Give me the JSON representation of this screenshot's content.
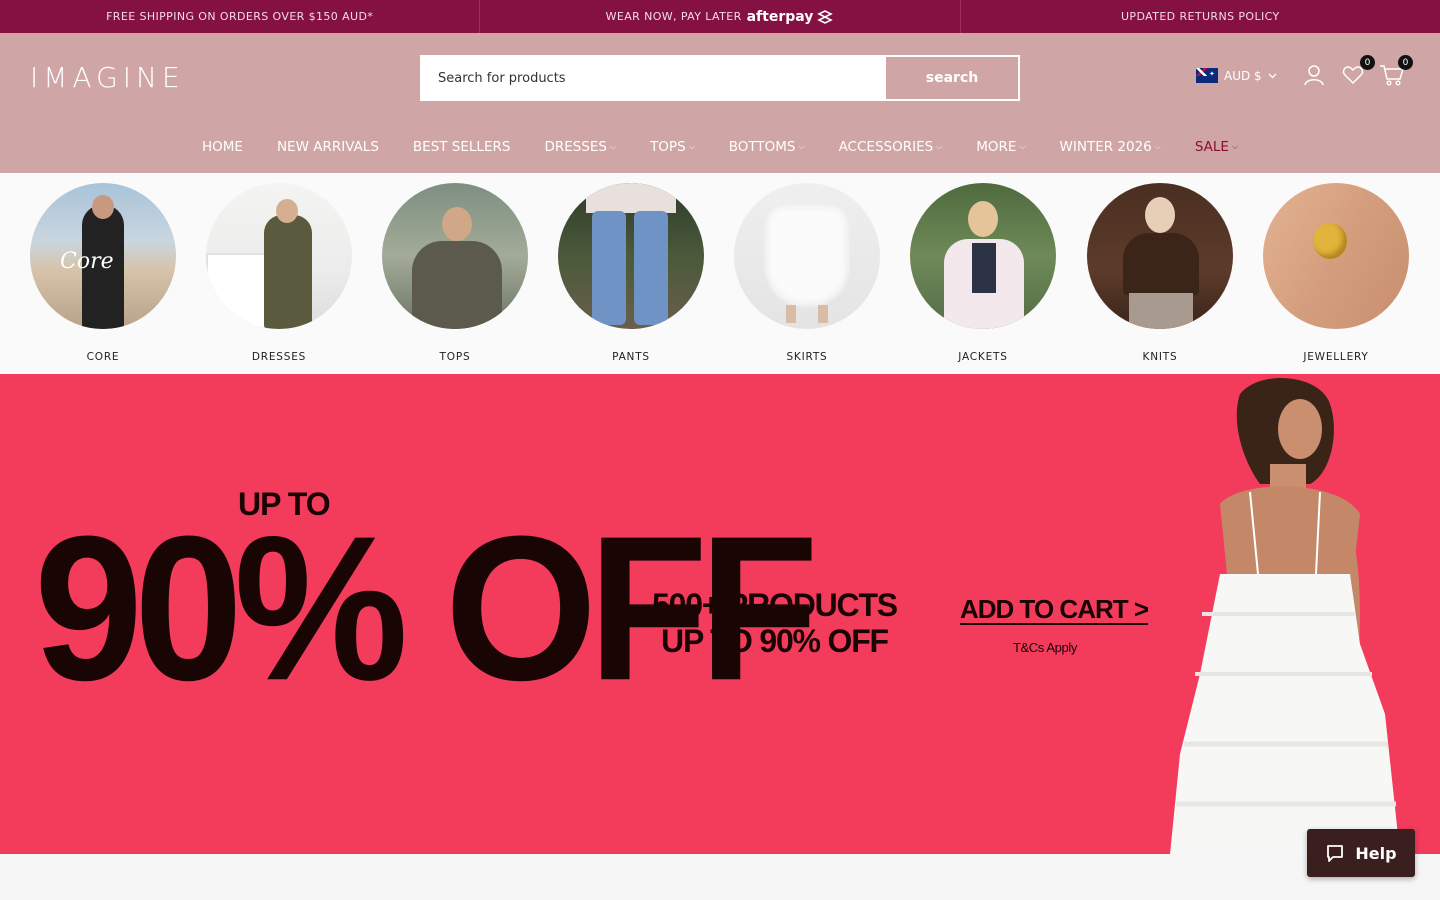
{
  "announcement": {
    "shipping": "FREE SHIPPING ON ORDERS OVER $150 AUD*",
    "wear_now": "WEAR NOW, PAY LATER",
    "afterpay": "afterpay",
    "returns": "UPDATED RETURNS POLICY"
  },
  "header": {
    "logo": "IMAGINE",
    "search_placeholder": "Search for products",
    "search_button": "search",
    "currency": "AUD $",
    "wishlist_count": "0",
    "cart_count": "0"
  },
  "nav": [
    {
      "label": "HOME",
      "dropdown": false
    },
    {
      "label": "NEW ARRIVALS",
      "dropdown": false
    },
    {
      "label": "BEST SELLERS",
      "dropdown": false
    },
    {
      "label": "DRESSES",
      "dropdown": true
    },
    {
      "label": "TOPS",
      "dropdown": true
    },
    {
      "label": "BOTTOMS",
      "dropdown": true
    },
    {
      "label": "ACCESSORIES",
      "dropdown": true
    },
    {
      "label": "MORE",
      "dropdown": true
    },
    {
      "label": "WINTER 2026",
      "dropdown": true
    },
    {
      "label": "SALE",
      "dropdown": true
    }
  ],
  "categories": [
    {
      "label": "CORE"
    },
    {
      "label": "DRESSES"
    },
    {
      "label": "TOPS"
    },
    {
      "label": "PANTS"
    },
    {
      "label": "SKIRTS"
    },
    {
      "label": "JACKETS"
    },
    {
      "label": "KNITS"
    },
    {
      "label": "JEWELLERY"
    }
  ],
  "hero": {
    "upto": "UP TO",
    "big": "90% OFF",
    "mid_line1": "500+ PRODUCTS",
    "mid_line2": "UP TO 90% OFF",
    "cta": "ADD TO CART >",
    "tcs": "T&Cs Apply"
  },
  "help": {
    "label": "Help"
  },
  "colors": {
    "announce_bg": "#851042",
    "header_bg": "#d0a5a5",
    "hero_bg": "#f33b5c",
    "sale_nav": "#8b0d2e",
    "help_bg": "#3b1e1e"
  }
}
